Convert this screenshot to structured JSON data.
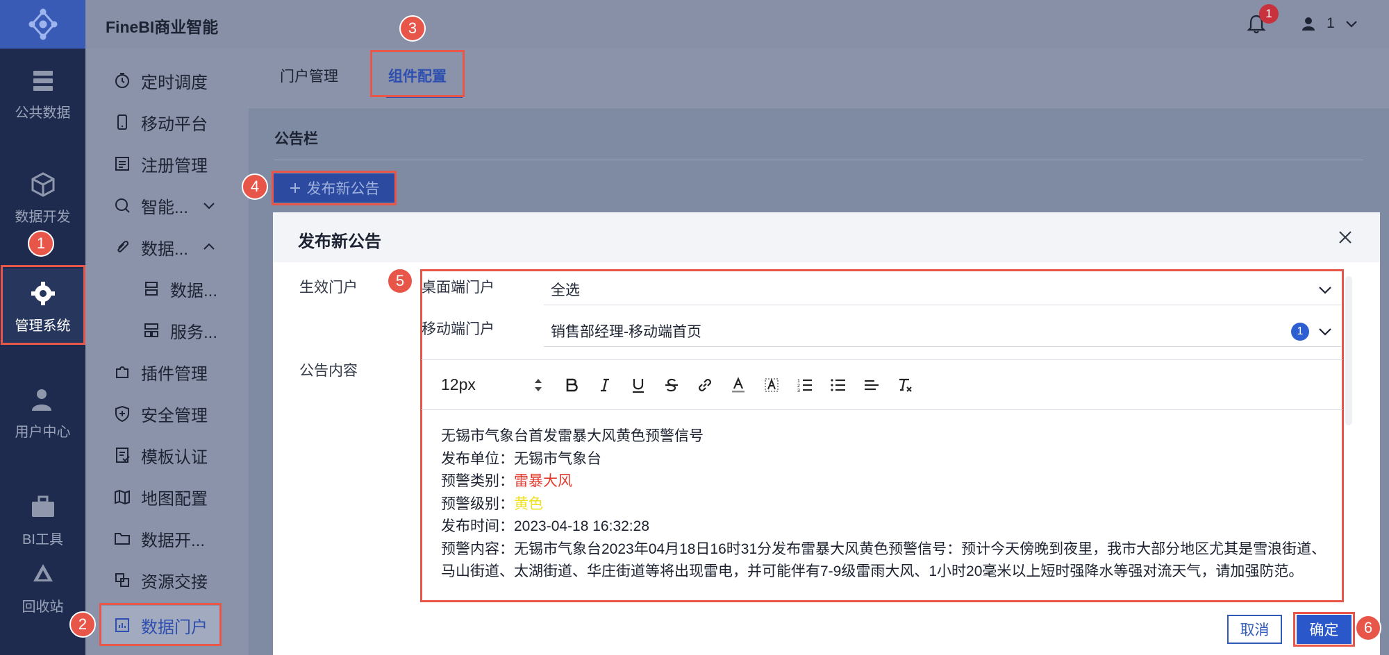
{
  "app": {
    "title": "FineBI商业智能"
  },
  "header": {
    "notification_count": "1",
    "user_name": "1"
  },
  "rail": {
    "items": [
      {
        "label": "公共数据",
        "icon": "server-icon"
      },
      {
        "label": "数据开发",
        "icon": "cube-icon"
      },
      {
        "label": "管理系统",
        "icon": "gear-icon",
        "active": true
      },
      {
        "label": "用户中心",
        "icon": "user-icon"
      },
      {
        "label": "BI工具",
        "icon": "toolbox-icon"
      },
      {
        "label": "回收站",
        "icon": "recycle-icon"
      }
    ]
  },
  "sidebar": {
    "items": [
      {
        "label": "定时调度",
        "icon": "timer-icon"
      },
      {
        "label": "移动平台",
        "icon": "phone-icon"
      },
      {
        "label": "注册管理",
        "icon": "register-icon"
      },
      {
        "label": "智能...",
        "icon": "smart-icon"
      },
      {
        "label": "数据...",
        "icon": "clip-icon"
      },
      {
        "label": "数据...",
        "icon": "db-icon"
      },
      {
        "label": "服务...",
        "icon": "service-icon"
      },
      {
        "label": "插件管理",
        "icon": "puzzle-icon"
      },
      {
        "label": "安全管理",
        "icon": "shield-icon"
      },
      {
        "label": "模板认证",
        "icon": "cert-icon"
      },
      {
        "label": "地图配置",
        "icon": "map-icon"
      },
      {
        "label": "数据开...",
        "icon": "folder-icon"
      },
      {
        "label": "资源交接",
        "icon": "transfer-icon"
      },
      {
        "label": "数据门户",
        "icon": "portal-icon",
        "active": true
      }
    ]
  },
  "tabs": [
    {
      "label": "门户管理"
    },
    {
      "label": "组件配置",
      "active": true
    }
  ],
  "bulletin": {
    "section_title": "公告栏",
    "publish_button": "发布新公告"
  },
  "modal": {
    "title": "发布新公告",
    "label_portal": "生效门户",
    "label_content": "公告内容",
    "desktop_label": "桌面端门户",
    "desktop_value": "全选",
    "mobile_label": "移动端门户",
    "mobile_value": "销售部经理-移动端首页",
    "mobile_count": "1",
    "font_size": "12px",
    "content": {
      "line1": "无锡市气象台首发雷暴大风黄色预警信号",
      "unit_label": "发布单位：",
      "unit_value": "无锡市气象台",
      "type_label": "预警类别：",
      "type_value": "雷暴大风",
      "level_label": "预警级别：",
      "level_value": "黄色",
      "time_label": "发布时间：",
      "time_value": "2023-04-18 16:32:28",
      "detail_label": "预警内容：",
      "detail_value": "无锡市气象台2023年04月18日16时31分发布雷暴大风黄色预警信号：预计今天傍晚到夜里，我市大部分地区尤其是雪浪街道、马山街道、太湖街道、华庄街道等将出现雷电，并可能伴有7-9级雷雨大风、1小时20毫米以上短时强降水等强对流天气，请加强防范。"
    },
    "cancel_label": "取消",
    "ok_label": "确定"
  },
  "callouts": [
    "1",
    "2",
    "3",
    "4",
    "5",
    "6"
  ],
  "colors": {
    "accent": "#2f4fb0",
    "highlight": "#e8564a",
    "warning_red": "#e43a2d",
    "warning_yellow": "#f0e01c"
  }
}
